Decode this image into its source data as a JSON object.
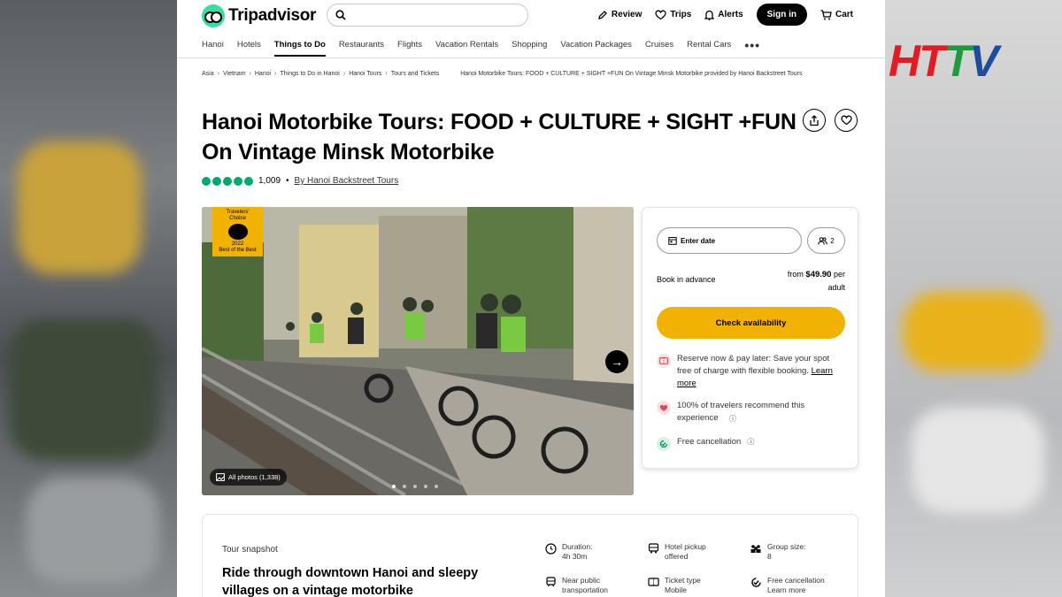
{
  "header": {
    "logo_text": "Tripadvisor",
    "search_placeholder": "",
    "review": "Review",
    "trips": "Trips",
    "alerts": "Alerts",
    "signin": "Sign in",
    "cart": "Cart"
  },
  "nav": [
    "Hanoi",
    "Hotels",
    "Things to Do",
    "Restaurants",
    "Flights",
    "Vacation Rentals",
    "Shopping",
    "Vacation Packages",
    "Cruises",
    "Rental Cars"
  ],
  "nav_more": "•••",
  "breadcrumbs": [
    "Asia",
    "Vietnam",
    "Hanoi",
    "Things to Do in Hanoi",
    "Hanoi Tours",
    "Tours and Tickets"
  ],
  "breadcrumb_current": "Hanoi Motorbike Tours: FOOD + CULTURE + SIGHT +FUN On Vintage Minsk Motorbike provided by Hanoi Backstreet Tours",
  "title": "Hanoi Motorbike Tours: FOOD + CULTURE + SIGHT +FUN On Vintage Minsk Motorbike",
  "rating": {
    "bubbles": 5,
    "count": "1,009",
    "bullet": "•",
    "by": "By Hanoi Backstreet Tours"
  },
  "badge": {
    "line1": "Travelers'",
    "line2": "Choice",
    "year": "2022",
    "sub": "Best of the Best"
  },
  "photo": {
    "all_photos": "All photos (1,338)",
    "dot_count": 5,
    "active_dot": 0
  },
  "booking": {
    "date_placeholder": "Enter date",
    "guests": "2",
    "book_label": "Book in advance",
    "price_from": "from",
    "price": "$49.90",
    "price_per": "per",
    "price_unit": "adult",
    "check_button": "Check availability",
    "reserve_text": "Reserve now & pay later: Save your spot free of charge with flexible booking.",
    "learn_more": "Learn more",
    "recommend_text": "100% of travelers recommend this experience",
    "cancel_text": "Free cancellation"
  },
  "snapshot": {
    "label": "Tour snapshot",
    "headline": "Ride through downtown Hanoi and sleepy villages on a vintage motorbike",
    "items": [
      {
        "title": "Duration:",
        "value": "4h 30m"
      },
      {
        "title": "Hotel pickup",
        "value": "offered"
      },
      {
        "title": "Group size:",
        "value": "8"
      },
      {
        "title": "Near public",
        "value": "transportation"
      },
      {
        "title": "Ticket type",
        "value": "Mobile"
      },
      {
        "title": "Free cancellation",
        "value": "Learn more"
      }
    ]
  },
  "watermark": {
    "h": "H",
    "t1": "T",
    "t2": "T",
    "v": "V"
  },
  "colors": {
    "brand_green": "#34e0a1",
    "rating_green": "#00aa6c",
    "cta_yellow": "#f2b203"
  }
}
